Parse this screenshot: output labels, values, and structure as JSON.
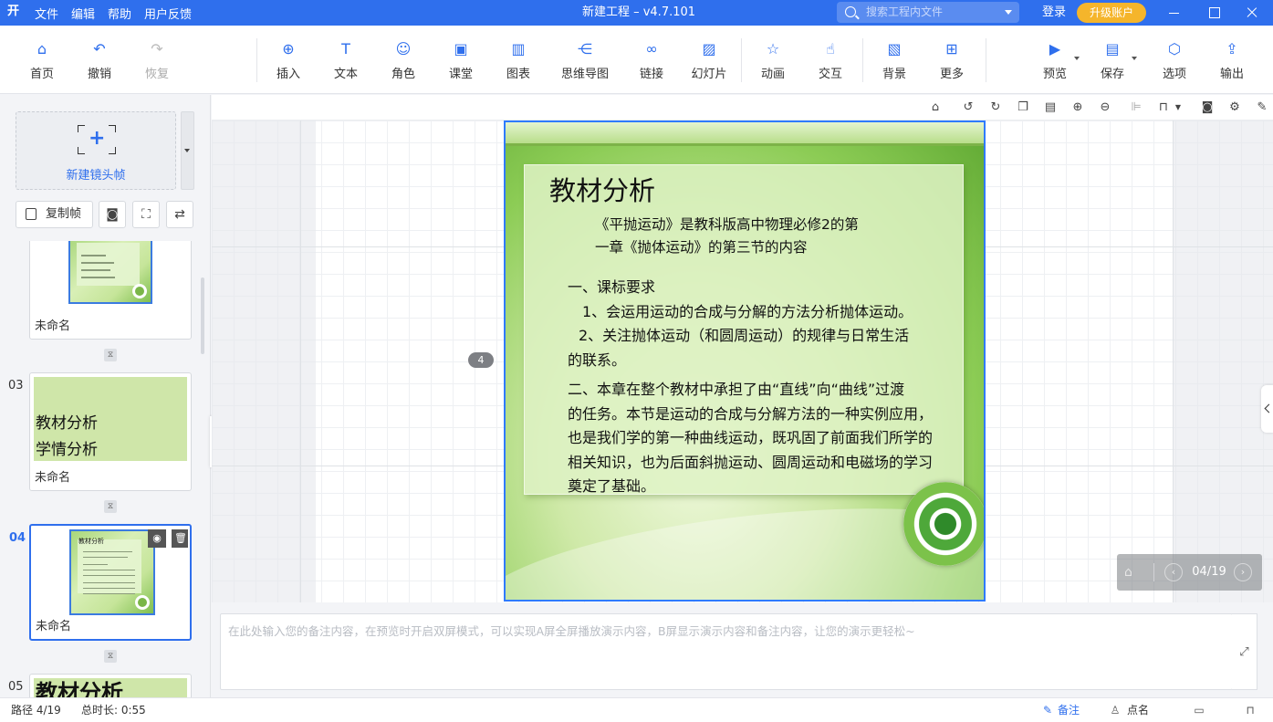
{
  "titlebar": {
    "logo": "开",
    "menu": [
      "文件",
      "编辑",
      "帮助",
      "用户反馈"
    ],
    "title": "新建工程 – v4.7.101",
    "search_placeholder": "搜索工程内文件",
    "login": "登录",
    "upgrade": "升级账户"
  },
  "toolbar": {
    "home": "首页",
    "undo": "撤销",
    "redo": "恢复",
    "insert": "插入",
    "text": "文本",
    "role": "角色",
    "classroom": "课堂",
    "chart": "图表",
    "mindmap": "思维导图",
    "link": "链接",
    "slideshow": "幻灯片",
    "animation": "动画",
    "interaction": "交互",
    "background": "背景",
    "more": "更多",
    "preview": "预览",
    "save": "保存",
    "options": "选项",
    "export": "输出"
  },
  "leftpanel": {
    "new_frame": "新建镜头帧",
    "copy_frame": "复制帧",
    "frames": [
      {
        "num": "",
        "name": "未命名"
      },
      {
        "num": "03",
        "name": "未命名",
        "line1": "教材分析",
        "line2": "学情分析"
      },
      {
        "num": "04",
        "name": "未命名",
        "mini_title": "教材分析"
      },
      {
        "num": "05",
        "name": "",
        "big_text": "教材分析"
      }
    ]
  },
  "slide": {
    "badge": "4",
    "title": "教材分析",
    "intro_1": "《平抛运动》是教科版高中物理必修2的第",
    "intro_2": "一章《抛体运动》的第三节的内容",
    "s1_heading": "一、课标要求",
    "s1_item1": "1、会运用运动的合成与分解的方法分析抛体运动。",
    "s1_item2": "2、关注抛体运动（和圆周运动）的规律与日常生活",
    "s1_item2_cont": "的联系。",
    "s2_line1": "二、本章在整个教材中承担了由“直线”向“曲线”过渡",
    "s2_line2": "的任务。本节是运动的合成与分解方法的一种实例应用，",
    "s2_line3": "也是我们学的第一种曲线运动，既巩固了前面我们所学的",
    "s2_line4": "相关知识，也为后面斜抛运动、圆周运动和电磁场的学习",
    "s2_line5": "奠定了基础。"
  },
  "pager": {
    "page": "04/19"
  },
  "notes": {
    "placeholder": "在此处输入您的备注内容，在预览时开启双屏模式，可以实现A屏全屏播放演示内容，B屏显示演示内容和备注内容，让您的演示更轻松~"
  },
  "statusbar": {
    "path": "路径 4/19",
    "duration": "总时长: 0:55",
    "notes": "备注",
    "rollcall": "点名"
  },
  "colors": {
    "accent": "#2f6fed",
    "upgrade": "#f5b52b",
    "selection": "#2f7bff"
  }
}
